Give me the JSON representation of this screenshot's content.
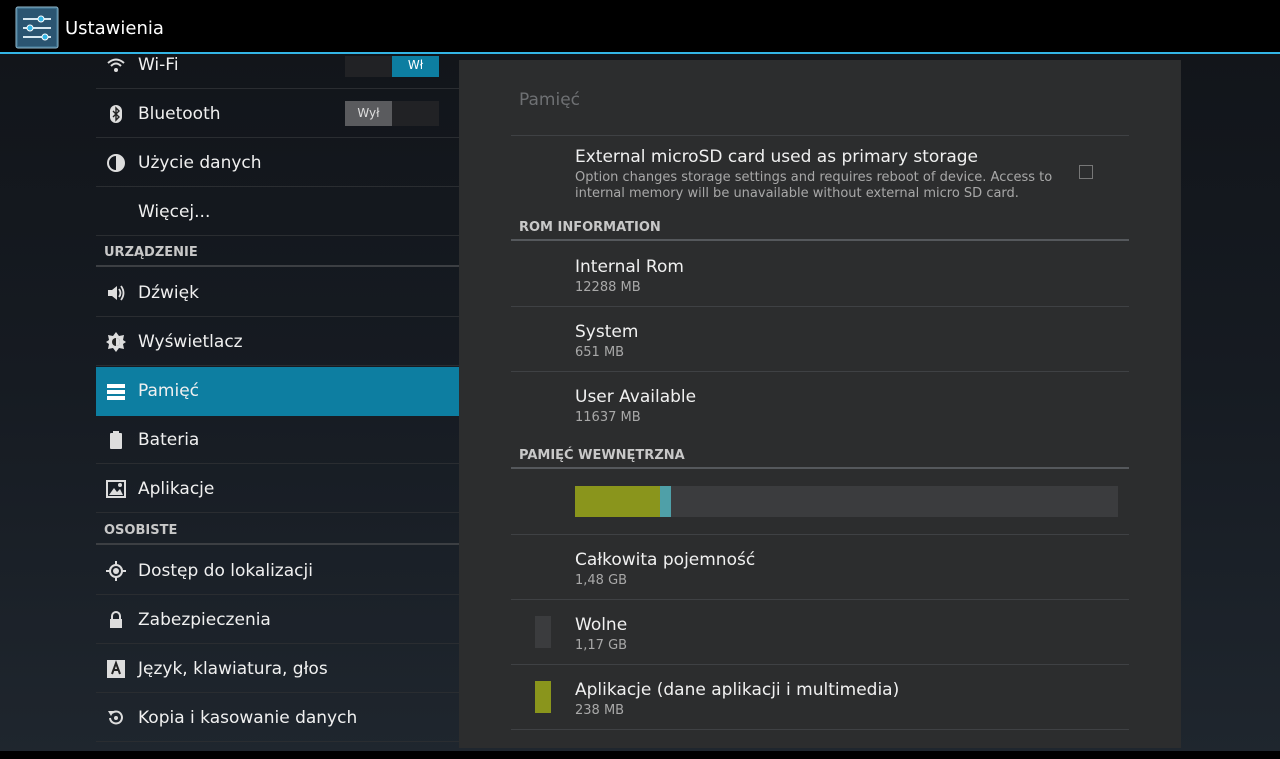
{
  "app": {
    "title": "Ustawienia",
    "icon": "settings-sliders-icon"
  },
  "sidebar": {
    "items": [
      {
        "label": "Wi-Fi",
        "icon": "wifi-icon"
      },
      {
        "label": "Bluetooth",
        "icon": "bluetooth-icon"
      },
      {
        "label": "Użycie danych",
        "icon": "data-usage-icon"
      },
      {
        "label": "Więcej...",
        "icon": ""
      },
      {
        "label": "Dźwięk",
        "icon": "speaker-icon"
      },
      {
        "label": "Wyświetlacz",
        "icon": "brightness-icon"
      },
      {
        "label": "Pamięć",
        "icon": "storage-icon",
        "selected": true
      },
      {
        "label": "Bateria",
        "icon": "battery-icon"
      },
      {
        "label": "Aplikacje",
        "icon": "apps-icon"
      },
      {
        "label": "Dostęp do lokalizacji",
        "icon": "location-icon"
      },
      {
        "label": "Zabezpieczenia",
        "icon": "lock-icon"
      },
      {
        "label": "Język, klawiatura, głos",
        "icon": "language-icon"
      },
      {
        "label": "Kopia i kasowanie danych",
        "icon": "backup-restore-icon"
      }
    ],
    "headers": {
      "device": "URZĄDZENIE",
      "personal": "OSOBISTE"
    },
    "wifi_toggle": {
      "label": "Wł",
      "state": "on"
    },
    "bluetooth_toggle": {
      "label": "Wył",
      "state": "off"
    }
  },
  "panel": {
    "title": "Pamięć",
    "external_sd": {
      "title": "External microSD card used as primary storage",
      "subtitle_line1": "Option changes storage settings and requires reboot of device. Access to",
      "subtitle_line2": "internal memory will be unavailable without external micro SD card.",
      "checked": false
    },
    "rom_header": "ROM INFORMATION",
    "rom": [
      {
        "title": "Internal Rom",
        "value": "12288 MB"
      },
      {
        "title": "System",
        "value": "651 MB"
      },
      {
        "title": "User Available",
        "value": "11637 MB"
      }
    ],
    "internal_header": "PAMIĘĆ WEWNĘTRZNA",
    "usage_bar": {
      "apps_fraction": 0.157,
      "misc_fraction": 0.021
    },
    "internal": [
      {
        "title": "Całkowita pojemność",
        "value": "1,48 GB"
      },
      {
        "title": "Wolne",
        "value": "1,17 GB",
        "swatch": "#3b3c3e"
      },
      {
        "title": "Aplikacje (dane aplikacji i multimedia)",
        "value": "238 MB",
        "swatch": "#8a951c"
      }
    ]
  },
  "colors": {
    "accent": "#33b5e5",
    "selected": "#0d7ea1",
    "apps": "#8a951c",
    "misc": "#4fa0a8"
  }
}
